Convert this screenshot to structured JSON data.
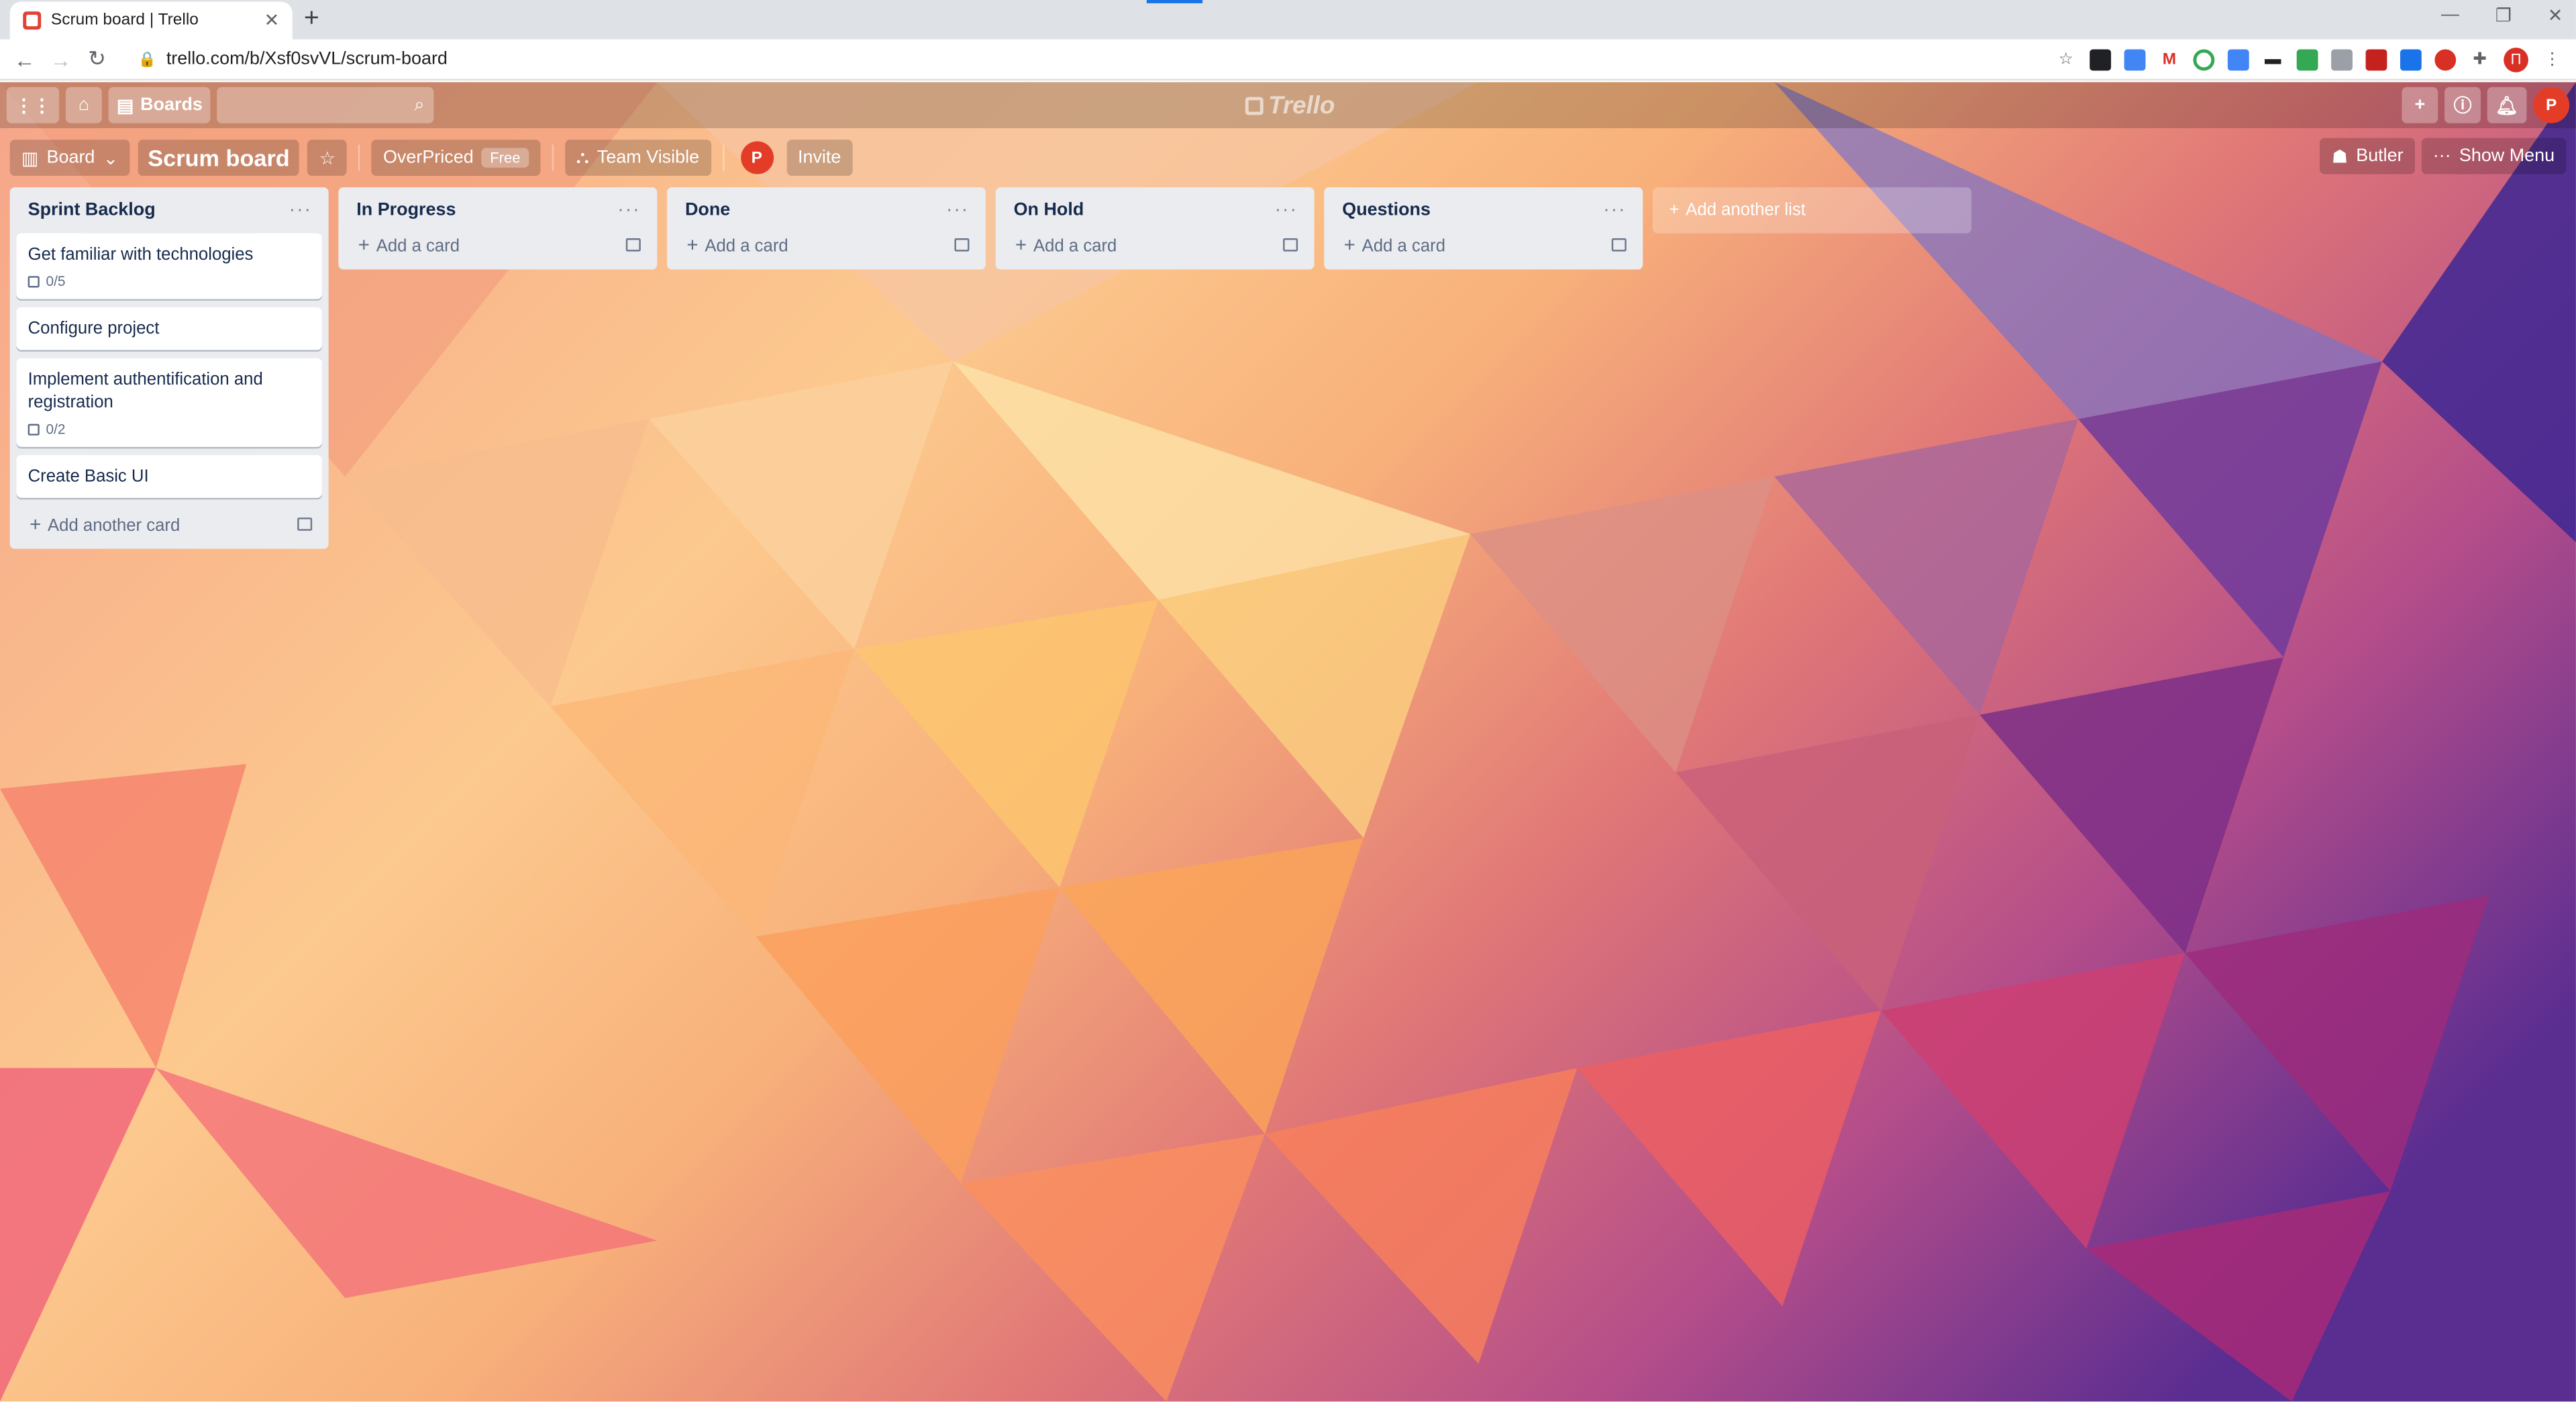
{
  "browser": {
    "tab_title": "Scrum board | Trello",
    "url": "trello.com/b/Xsf0svVL/scrum-board",
    "profile_initial": "П"
  },
  "trello": {
    "header": {
      "boards_label": "Boards",
      "logo_text": "Trello",
      "user_initial": "P"
    },
    "board": {
      "view_label": "Board",
      "name": "Scrum board",
      "team_name": "OverPriced",
      "team_badge": "Free",
      "visibility_label": "Team Visible",
      "member_initial": "P",
      "invite_label": "Invite",
      "butler_label": "Butler",
      "show_menu_label": "Show Menu"
    },
    "lists": [
      {
        "title": "Sprint Backlog",
        "cards": [
          {
            "title": "Get familiar with technologies",
            "checklist": "0/5"
          },
          {
            "title": "Configure project",
            "checklist": ""
          },
          {
            "title": "Implement authentification and registration",
            "checklist": "0/2"
          },
          {
            "title": "Create Basic UI",
            "checklist": ""
          }
        ],
        "add_label": "Add another card"
      },
      {
        "title": "In Progress",
        "cards": [],
        "add_label": "Add a card"
      },
      {
        "title": "Done",
        "cards": [],
        "add_label": "Add a card"
      },
      {
        "title": "On Hold",
        "cards": [],
        "add_label": "Add a card"
      },
      {
        "title": "Questions",
        "cards": [],
        "add_label": "Add a card"
      }
    ],
    "add_list_label": "Add another list"
  },
  "colors": {
    "list_bg": "#ebecf0",
    "avatar": "#e33d27",
    "text": "#172b4d"
  }
}
